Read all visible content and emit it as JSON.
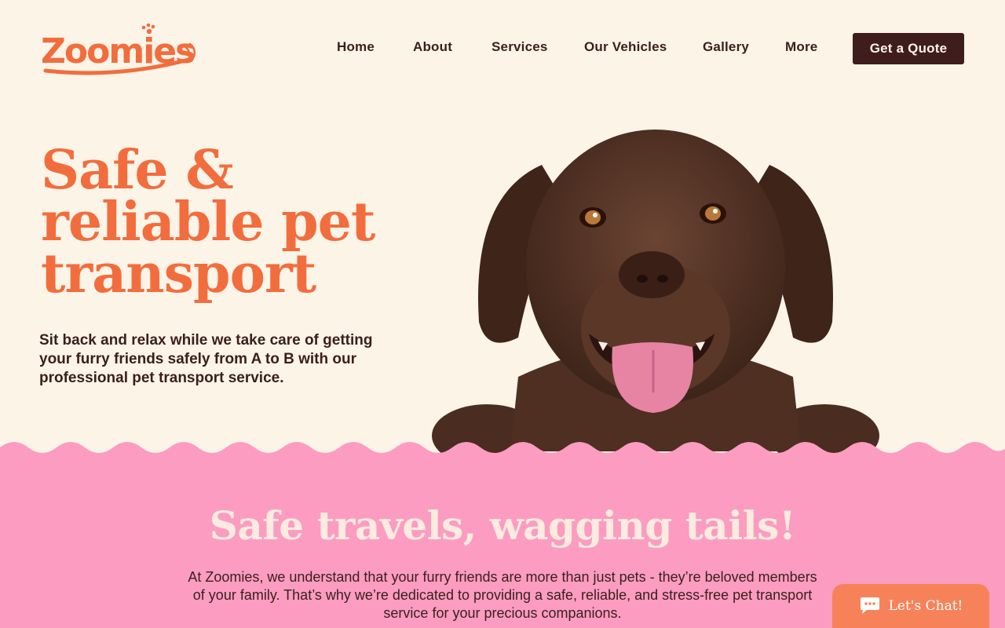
{
  "brand": {
    "name": "Zoomies",
    "logo_color": "#f26d3d"
  },
  "nav": {
    "items": [
      {
        "label": "Home"
      },
      {
        "label": "About"
      },
      {
        "label": "Services"
      },
      {
        "label": "Our Vehicles"
      },
      {
        "label": "Gallery"
      },
      {
        "label": "More"
      }
    ],
    "cta_label": "Get a Quote"
  },
  "hero": {
    "title_line1": "Safe &",
    "title_line2": "reliable pet",
    "title_line3": "transport",
    "subtitle": "Sit back and relax while we take care of getting your furry friends safely from A to B with our professional pet transport service.",
    "image_subject": "chocolate labrador puppy"
  },
  "section": {
    "title": "Safe travels, wagging tails!",
    "body": "At Zoomies, we understand that your furry friends are more than just pets - they’re beloved members of your family. That’s why we’re dedicated to providing a safe, reliable, and stress-free pet transport service for your precious companions."
  },
  "chat": {
    "label": "Let's Chat!",
    "icon": "chat-bubble-icon"
  },
  "colors": {
    "background": "#fdf4e8",
    "accent": "#f26d3d",
    "dark": "#3f1d1c",
    "pink": "#fb9cc0",
    "chat": "#f7825a"
  }
}
